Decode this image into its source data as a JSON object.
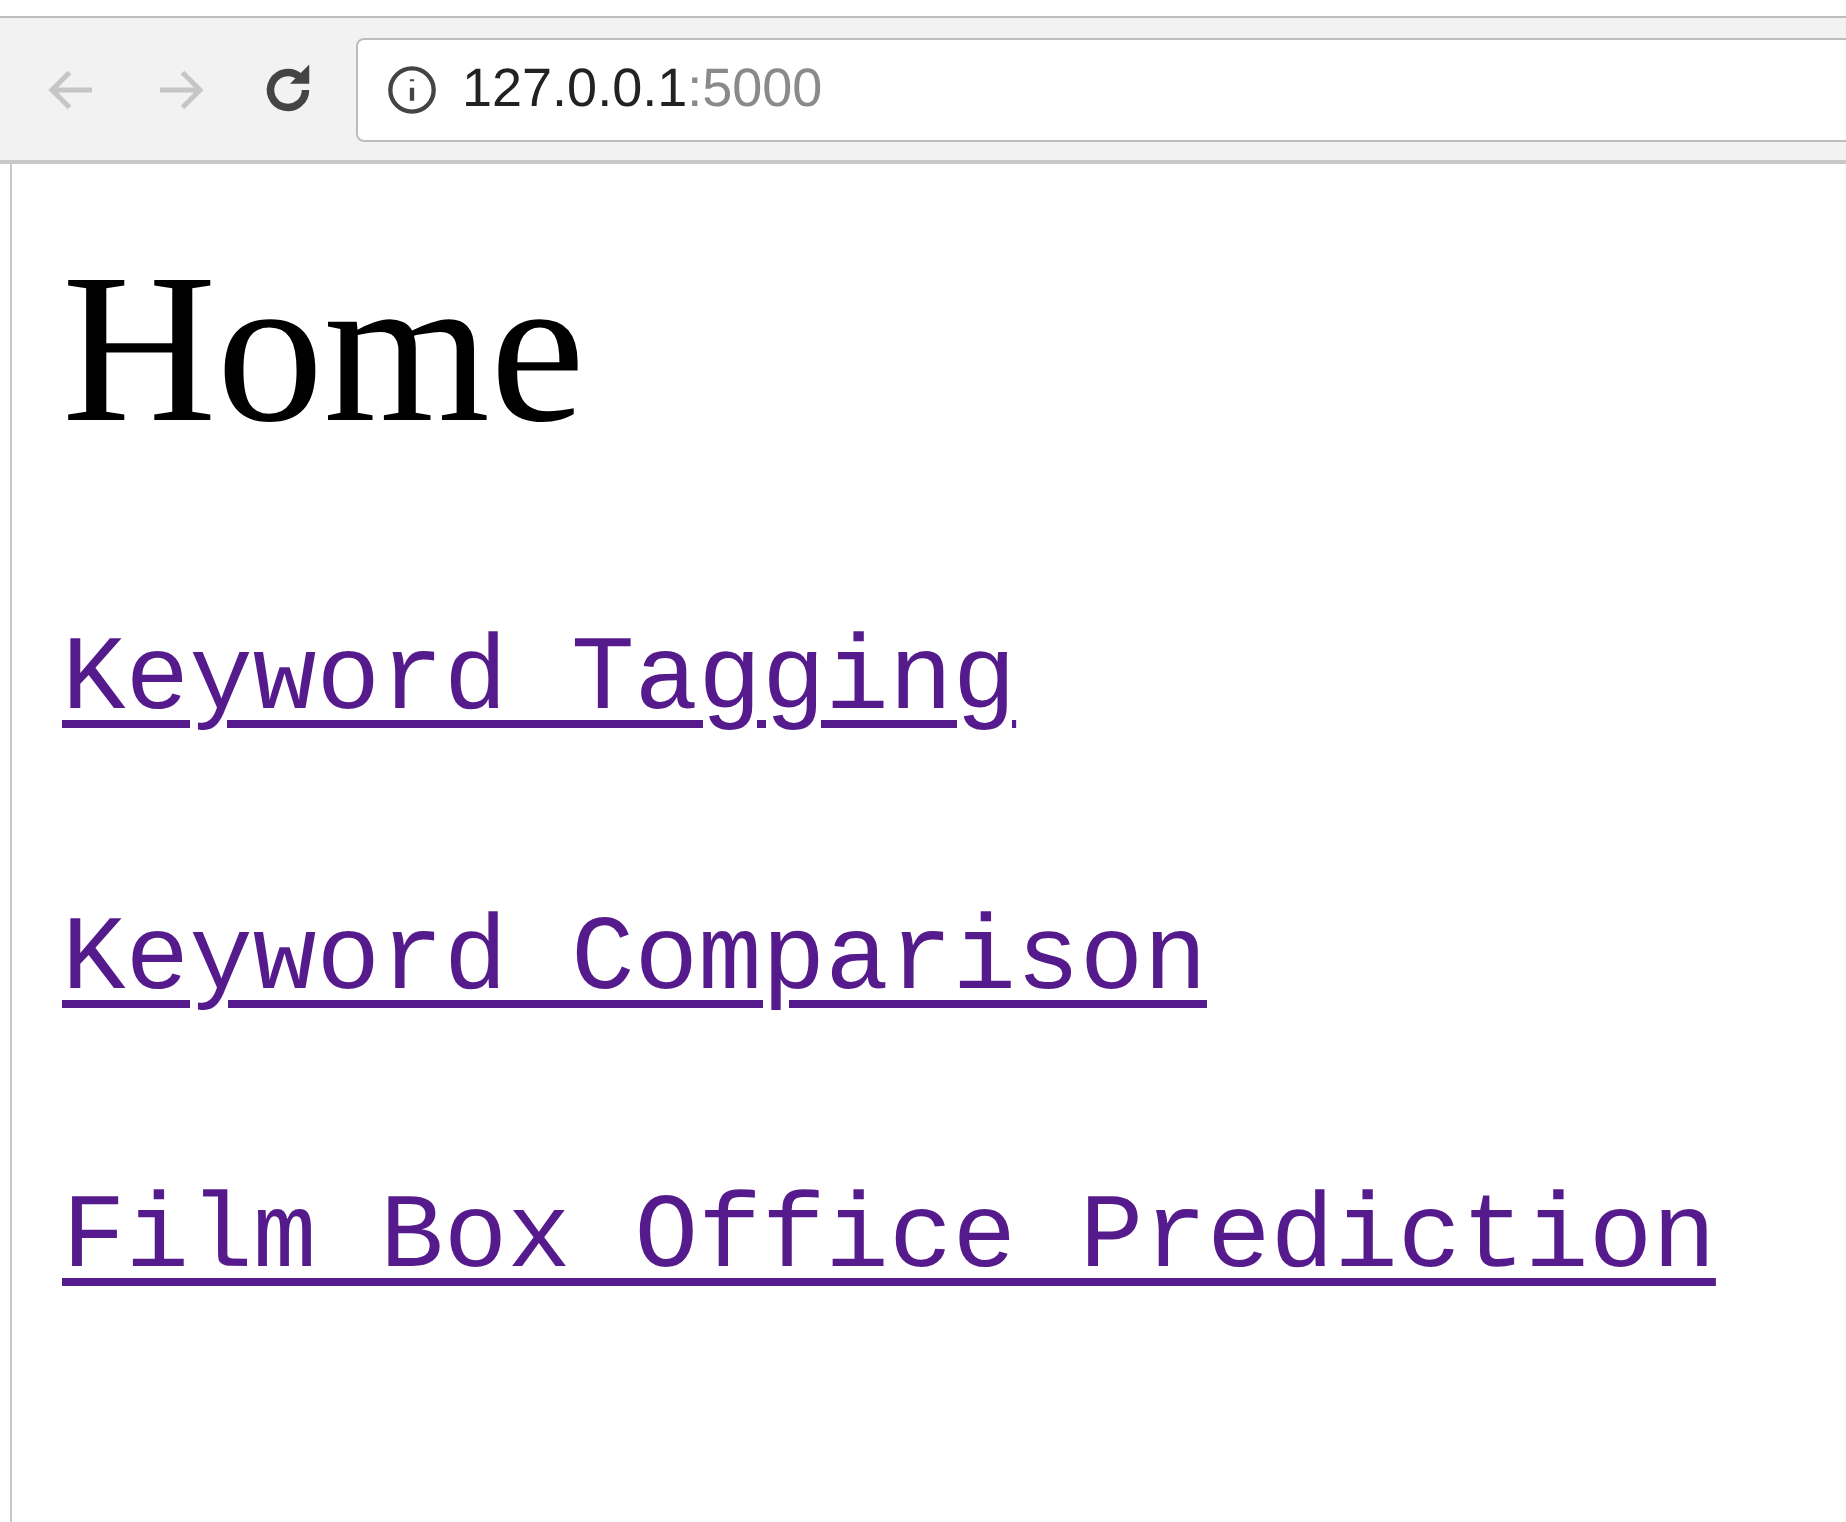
{
  "toolbar": {
    "back": {
      "disabled": true
    },
    "forward": {
      "disabled": true
    },
    "address": {
      "host": "127.0.0.1",
      "port": ":5000"
    }
  },
  "page": {
    "heading": "Home",
    "links": [
      {
        "label": "Keyword Tagging",
        "visited": true
      },
      {
        "label": "Keyword Comparison",
        "visited": true
      },
      {
        "label": "Film Box Office Prediction",
        "visited": true
      }
    ]
  }
}
